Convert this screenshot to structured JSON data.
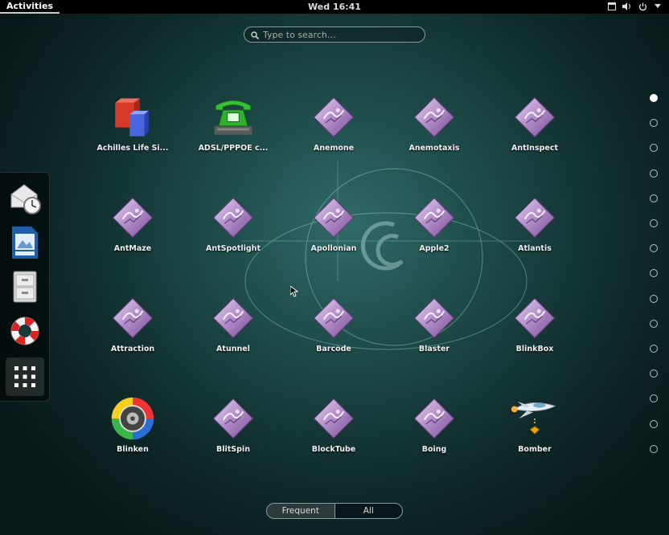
{
  "topbar": {
    "activities": "Activities",
    "clock": "Wed 16:41",
    "tray_icons": [
      "window-icon",
      "volume-icon",
      "power-icon",
      "chevron-down-icon"
    ]
  },
  "search": {
    "placeholder": "Type to search…"
  },
  "dash": {
    "items": [
      {
        "name": "mail-clock",
        "icon": "mail-clock-icon"
      },
      {
        "name": "document",
        "icon": "document-icon"
      },
      {
        "name": "file-cabinet",
        "icon": "file-cabinet-icon"
      },
      {
        "name": "help",
        "icon": "lifebuoy-icon"
      },
      {
        "name": "show-applications",
        "icon": "grid-icon"
      }
    ]
  },
  "apps": [
    {
      "label": "Achilles Life Si...",
      "icon": "cubes-icon"
    },
    {
      "label": "ADSL/PPPOE c...",
      "icon": "telephone-icon"
    },
    {
      "label": "Anemone",
      "icon": "screensaver-icon"
    },
    {
      "label": "Anemotaxis",
      "icon": "screensaver-icon"
    },
    {
      "label": "AntInspect",
      "icon": "screensaver-icon"
    },
    {
      "label": "AntMaze",
      "icon": "screensaver-icon"
    },
    {
      "label": "AntSpotlight",
      "icon": "screensaver-icon"
    },
    {
      "label": "Apollonian",
      "icon": "screensaver-icon"
    },
    {
      "label": "Apple2",
      "icon": "screensaver-icon"
    },
    {
      "label": "Atlantis",
      "icon": "screensaver-icon"
    },
    {
      "label": "Attraction",
      "icon": "screensaver-icon"
    },
    {
      "label": "Atunnel",
      "icon": "screensaver-icon"
    },
    {
      "label": "Barcode",
      "icon": "screensaver-icon"
    },
    {
      "label": "Blaster",
      "icon": "screensaver-icon"
    },
    {
      "label": "BlinkBox",
      "icon": "screensaver-icon"
    },
    {
      "label": "Blinken",
      "icon": "blinken-icon"
    },
    {
      "label": "BlitSpin",
      "icon": "screensaver-icon"
    },
    {
      "label": "BlockTube",
      "icon": "screensaver-icon"
    },
    {
      "label": "Boing",
      "icon": "screensaver-icon"
    },
    {
      "label": "Bomber",
      "icon": "spaceship-icon"
    }
  ],
  "pages": {
    "total": 15,
    "current": 1
  },
  "switcher": {
    "frequent": "Frequent",
    "all": "All",
    "selected": "Frequent"
  },
  "colors": {
    "background": "#1d4a48",
    "screensaver_purple": "#a27bb8"
  }
}
